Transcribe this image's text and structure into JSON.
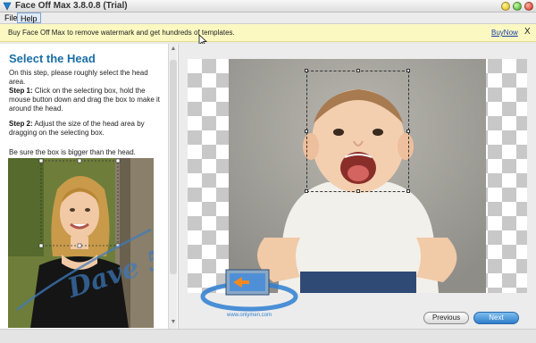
{
  "window": {
    "title": "Face Off Max  3.8.0.8  (Trial)",
    "app_icon": "faceoff-logo-icon",
    "controls": [
      "minimize-button",
      "maximize-button",
      "close-button"
    ]
  },
  "menu": {
    "file": "File",
    "help": "Help"
  },
  "banner": {
    "message": "Buy Face Off Max to remove watermark and get hundreds of templates.",
    "buy_link": "BuyNow",
    "close": "X"
  },
  "left_panel": {
    "title": "Select the Head",
    "intro": "On this step, please roughly select the head area.",
    "step1_label": "Step 1:",
    "step1_text": "Click on the selecting box, hold the mouse button down and drag the box to make it around the head.",
    "step2_label": "Step 2:",
    "step2_text": "Adjust the size of the head area by dragging on the selecting box.",
    "note": "Be sure the box is bigger than the head.",
    "sample_watermark": "Dave 5"
  },
  "canvas": {
    "image": "baby-photo",
    "logo_url": "www.onlymen.com"
  },
  "buttons": {
    "previous": "Previous",
    "next": "Next"
  },
  "colors": {
    "accent": "#1a6fa6",
    "banner_bg": "#fbf9c1",
    "link": "#1a3fa8",
    "next_button": "#2f7dca"
  }
}
